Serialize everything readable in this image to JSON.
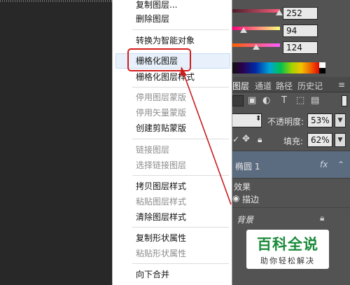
{
  "context_menu": {
    "items": [
      {
        "label": "复制图层...",
        "enabled": true
      },
      {
        "label": "删除图层",
        "enabled": true
      },
      {
        "label": "转换为智能对象",
        "enabled": true
      },
      {
        "label": "栅格化图层",
        "enabled": true,
        "highlighted": true
      },
      {
        "label": "栅格化图层样式",
        "enabled": true
      },
      {
        "label": "停用图层蒙版",
        "enabled": false
      },
      {
        "label": "停用矢量蒙版",
        "enabled": false
      },
      {
        "label": "创建剪贴蒙版",
        "enabled": true
      },
      {
        "label": "链接图层",
        "enabled": false
      },
      {
        "label": "选择链接图层",
        "enabled": false
      },
      {
        "label": "拷贝图层样式",
        "enabled": true
      },
      {
        "label": "粘贴图层样式",
        "enabled": false
      },
      {
        "label": "清除图层样式",
        "enabled": true
      },
      {
        "label": "复制形状属性",
        "enabled": true
      },
      {
        "label": "粘贴形状属性",
        "enabled": false
      },
      {
        "label": "向下合并",
        "enabled": true
      }
    ]
  },
  "color_panel": {
    "values": [
      "252",
      "94",
      "124"
    ],
    "slider_levels": [
      0.98,
      0.37,
      0.49
    ]
  },
  "layers_panel": {
    "tabs": [
      "图层",
      "通道",
      "路径",
      "历史记"
    ],
    "blend_mode": "",
    "opacity_label": "不透明度:",
    "opacity_value": "53%",
    "fill_label": "填充:",
    "fill_value": "62%",
    "layers": [
      {
        "name": "椭圆 1",
        "selected": true,
        "fx": "fx"
      },
      {
        "name": "背景",
        "locked": true
      }
    ],
    "effects_label": "效果",
    "stroke_label": "描边"
  },
  "watermark": {
    "title": "百科全说",
    "subtitle": "助你轻松解决"
  },
  "colors": {
    "highlight_box": "#d41c1c",
    "arrow": "#c81e1e",
    "selected_layer": "#5b6b80"
  }
}
